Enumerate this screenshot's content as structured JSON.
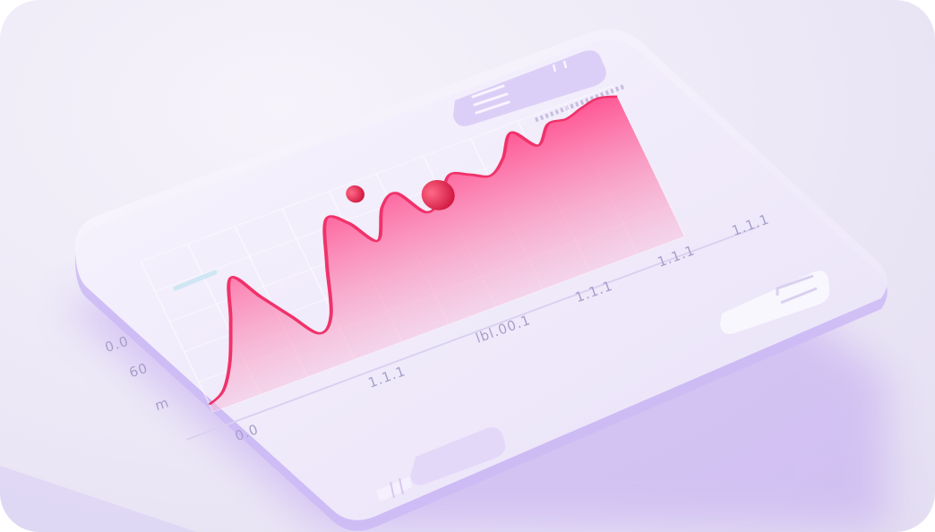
{
  "colors": {
    "background": "#ece8f6",
    "panel": "#f1ecfb",
    "panel_shadow": "#b89af0",
    "line": "#f0326a",
    "area_top": "#ff4f8e",
    "area_bottom": "#f7c3de",
    "marker": "#e8234f",
    "grid": "#ffffff",
    "label": "#a79ec9"
  },
  "icons": {
    "top_button": "menu-lines-icon",
    "right_button": "slider-icon",
    "bottom_button": "stacked-bars-icon"
  },
  "chart_data": {
    "type": "area",
    "title": "",
    "xlabel": "",
    "ylabel": "",
    "y_tick_labels": [
      "0.0",
      "60",
      "m"
    ],
    "x_tick_labels": [
      "0.0",
      "1.1.1",
      "lbl.00.1",
      "1.1.1",
      "1.1.1",
      "1.1.1"
    ],
    "x": [
      0,
      1,
      2,
      3,
      4,
      5,
      6,
      7,
      8,
      9,
      10,
      11,
      12,
      13,
      14,
      15,
      16,
      17,
      18,
      19,
      20,
      21,
      22,
      23,
      24,
      25,
      26,
      27
    ],
    "series": [
      {
        "values": [
          5,
          10,
          25,
          48,
          72,
          55,
          38,
          22,
          30,
          60,
          85,
          78,
          62,
          80,
          85,
          68,
          72,
          84,
          80,
          75,
          82,
          95,
          82,
          92,
          91,
          94,
          96,
          93
        ]
      }
    ],
    "markers": [
      {
        "x": 12,
        "y": 93
      },
      {
        "x": 16,
        "y": 75
      }
    ],
    "ylim": [
      0,
      100
    ],
    "grid": true,
    "legend": "none"
  }
}
